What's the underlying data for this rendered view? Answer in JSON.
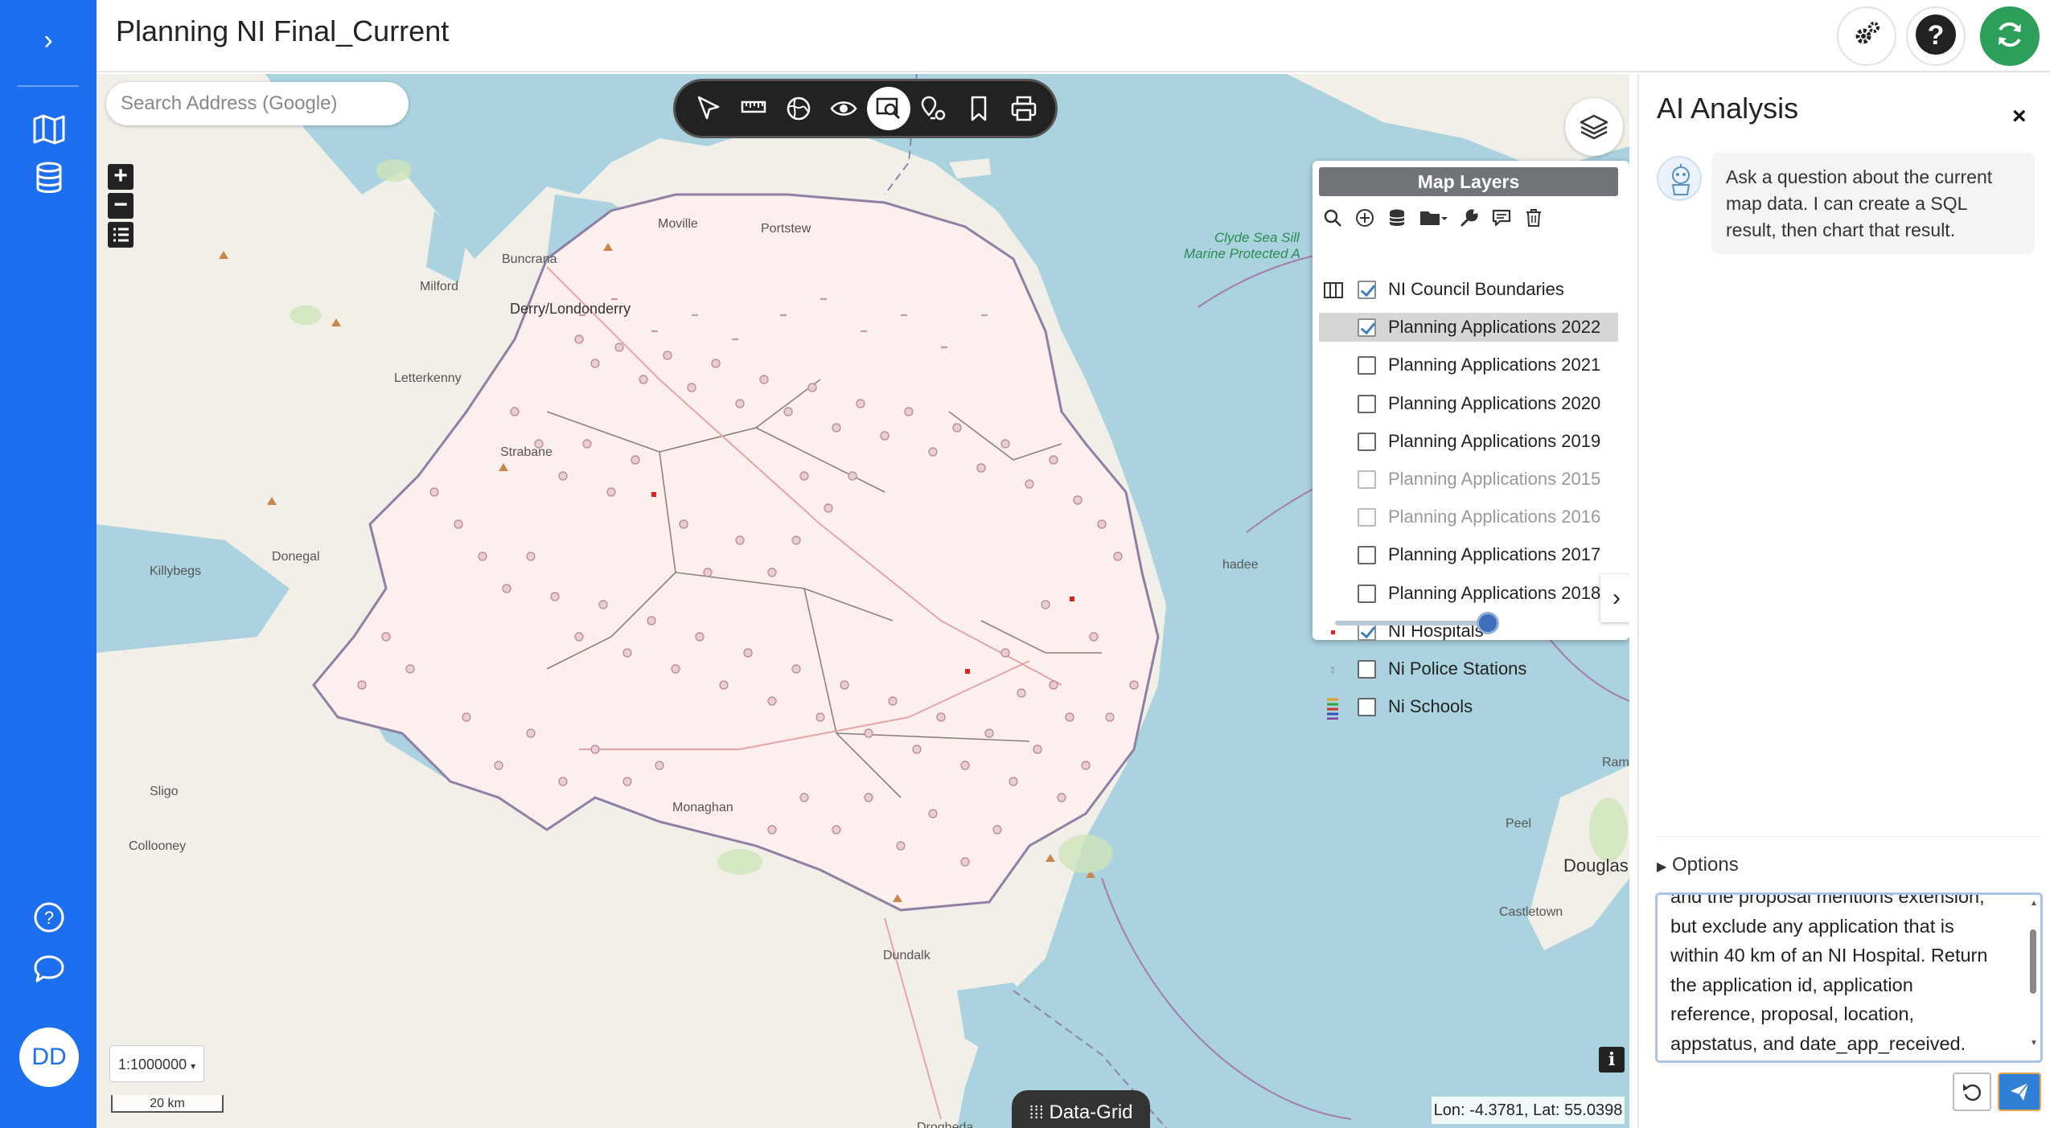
{
  "app": {
    "title": "Planning NI Final_Current",
    "user_initials": "DD"
  },
  "rail": {
    "expand_icon": "chevron-right-icon",
    "items": [
      "map-book-icon",
      "database-icon"
    ],
    "bottom": [
      "help-circle-icon",
      "chat-bubble-icon"
    ]
  },
  "header_buttons": [
    "settings-gears-icon",
    "help-icon",
    "refresh-icon"
  ],
  "map": {
    "search_placeholder": "Search Address (Google)",
    "toolbar": [
      "select-cursor-icon",
      "measure-ruler-icon",
      "globe-icon",
      "eye-icon",
      "search-area-icon",
      "location-pins-icon",
      "bookmark-icon",
      "print-icon"
    ],
    "active_tool": "search-area-icon",
    "zoom_in": "+",
    "zoom_out": "−",
    "scale": "1:1000000",
    "scalebar": "20 km",
    "data_grid": "Data-Grid",
    "coords": "Lon: -4.3781, Lat: 55.0398",
    "info": "i",
    "labels": {
      "moville": "Moville",
      "portstewart": "Portstew",
      "buncrana": "Buncrana",
      "milford": "Milford",
      "derry": "Derry/Londonderry",
      "letterkenny": "Letterkenny",
      "strabane": "Strabane",
      "donegal": "Donegal",
      "killybegs": "Killybegs",
      "sligo": "Sligo",
      "collooney": "Collooney",
      "monaghan": "Monaghan",
      "dundalk": "Dundalk",
      "drogheda": "Drogheda",
      "clyde1": "Clyde Sea Sill",
      "clyde2": "Marine Protected A",
      "peel": "Peel",
      "douglas": "Douglas",
      "castletown": "Castletown",
      "ramsey": "Rams",
      "donaghadee": "hadee"
    },
    "colors": {
      "sea": "#aad3df",
      "land": "#f2efe9",
      "points": "#c9a0a8",
      "rail": "#1e6ff0"
    }
  },
  "layers": {
    "title": "Map Layers",
    "tools": [
      "search-icon",
      "add-circle-icon",
      "database-icon",
      "folder-icon",
      "wrench-icon",
      "comment-icon",
      "trash-icon"
    ],
    "items": [
      {
        "label": "NI Council Boundaries",
        "checked": true,
        "dim": false,
        "selected": false,
        "swatch": "boundary"
      },
      {
        "label": "Planning Applications 2022",
        "checked": true,
        "dim": false,
        "selected": true,
        "swatch": "none"
      },
      {
        "label": "Planning Applications 2021",
        "checked": false,
        "dim": false,
        "selected": false,
        "swatch": "none"
      },
      {
        "label": "Planning Applications 2020",
        "checked": false,
        "dim": false,
        "selected": false,
        "swatch": "none"
      },
      {
        "label": "Planning Applications 2019",
        "checked": false,
        "dim": false,
        "selected": false,
        "swatch": "none"
      },
      {
        "label": "Planning Applications 2015",
        "checked": false,
        "dim": true,
        "selected": false,
        "swatch": "none"
      },
      {
        "label": "Planning Applications 2016",
        "checked": false,
        "dim": true,
        "selected": false,
        "swatch": "none"
      },
      {
        "label": "Planning Applications 2017",
        "checked": false,
        "dim": false,
        "selected": false,
        "swatch": "none"
      },
      {
        "label": "Planning Applications 2018",
        "checked": false,
        "dim": false,
        "selected": false,
        "swatch": "none"
      },
      {
        "label": "NI Hospitals",
        "checked": true,
        "dim": false,
        "selected": false,
        "swatch": "reddot"
      },
      {
        "label": "Ni Police Stations",
        "checked": false,
        "dim": false,
        "selected": false,
        "swatch": "dots"
      },
      {
        "label": "Ni Schools",
        "checked": false,
        "dim": false,
        "selected": false,
        "swatch": "multi"
      }
    ],
    "opacity": 1.0,
    "expand": "›"
  },
  "ai": {
    "title": "AI Analysis",
    "close": "×",
    "greeting": "Ask a question about the current map data. I can create a SQL result, then chart that result.",
    "options_label": "Options",
    "prompt_lines": [
      "and the proposal mentions extension,",
      "but exclude any application that is",
      "within 40 km of an NI Hospital. Return",
      "the application id, application",
      "reference, proposal, location,",
      "appstatus, and date_app_received."
    ]
  }
}
